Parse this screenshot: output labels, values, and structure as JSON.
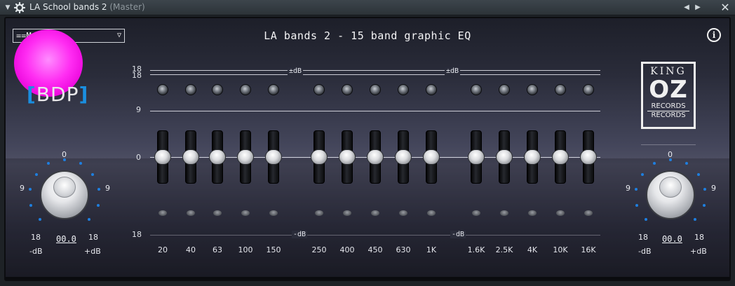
{
  "window": {
    "title": "LA School bands 2",
    "subtitle": "(Master)"
  },
  "plugin": {
    "preset_display": "==Master==",
    "eq_title": "LA bands 2 - 15 band graphic EQ",
    "bdp_logo_text": "BDP",
    "king_oz": {
      "king": "KING",
      "oz": "OZ",
      "records": "RECORDS",
      "records2": "RECORDS"
    },
    "scale": {
      "top_a": "18",
      "top_b": "18",
      "mid": "9",
      "zero": "0",
      "bottom": "18"
    },
    "db_up_label": "±dB",
    "db_down_label": "-dB",
    "bands": [
      {
        "freq": "20",
        "gain_db": 0
      },
      {
        "freq": "40",
        "gain_db": 0
      },
      {
        "freq": "63",
        "gain_db": 0
      },
      {
        "freq": "100",
        "gain_db": 0
      },
      {
        "freq": "150",
        "gain_db": 0
      },
      {
        "freq": "250",
        "gain_db": 0
      },
      {
        "freq": "400",
        "gain_db": 0
      },
      {
        "freq": "450",
        "gain_db": 0
      },
      {
        "freq": "630",
        "gain_db": 0
      },
      {
        "freq": "1K",
        "gain_db": 0
      },
      {
        "freq": "1.6K",
        "gain_db": 0
      },
      {
        "freq": "2.5K",
        "gain_db": 0
      },
      {
        "freq": "4K",
        "gain_db": 0
      },
      {
        "freq": "10K",
        "gain_db": 0
      },
      {
        "freq": "16K",
        "gain_db": 0
      }
    ],
    "left_dial": {
      "top": "0",
      "left": "9",
      "right": "9",
      "min": "18",
      "max": "18",
      "value": "00.0",
      "minus": "-dB",
      "plus": "+dB"
    },
    "right_dial": {
      "top": "0",
      "left": "9",
      "right": "9",
      "min": "18",
      "max": "18",
      "value": "00.0",
      "minus": "-dB",
      "plus": "+dB"
    },
    "colors": {
      "accent_blue": "#1a8fe0",
      "magenta": "#ff2cf2",
      "panel_bg": "#43455a"
    }
  }
}
